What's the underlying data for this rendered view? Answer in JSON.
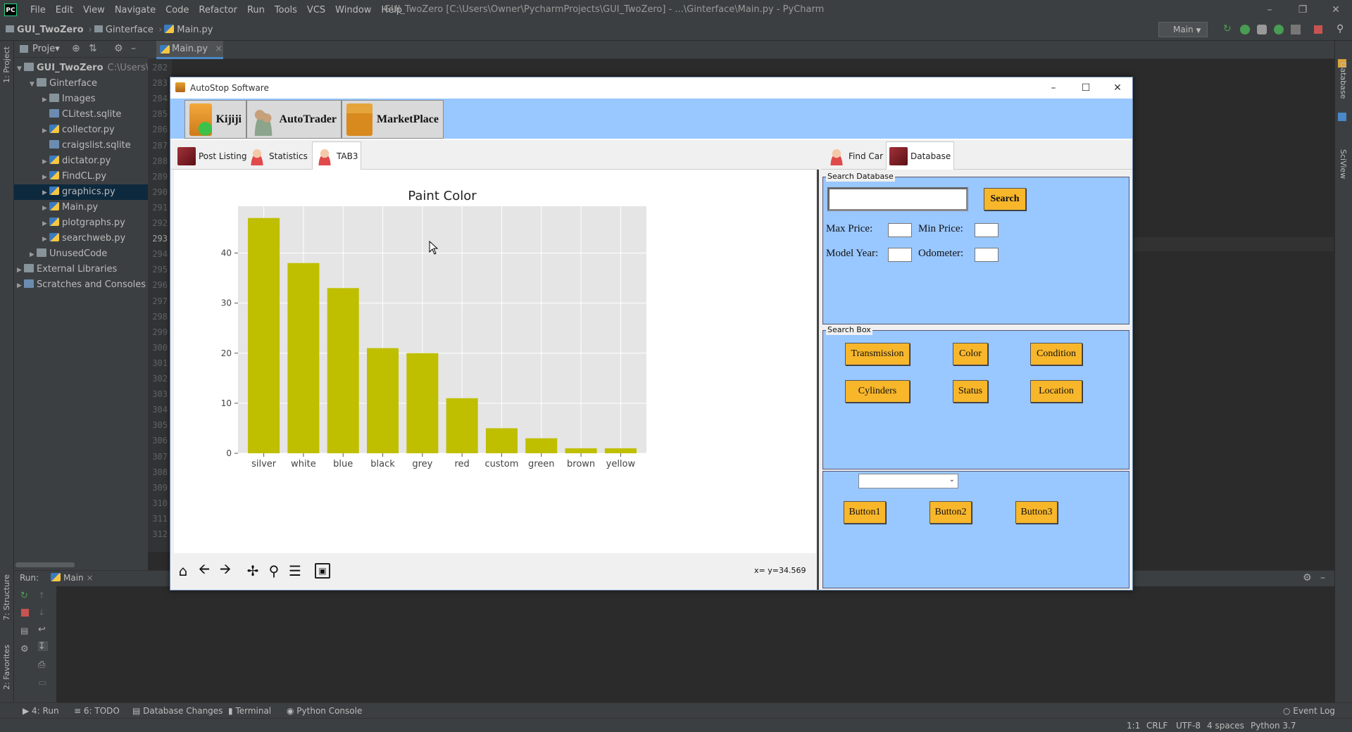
{
  "ide": {
    "menu": [
      "File",
      "Edit",
      "View",
      "Navigate",
      "Code",
      "Refactor",
      "Run",
      "Tools",
      "VCS",
      "Window",
      "Help"
    ],
    "window_title": "GUI_TwoZero [C:\\Users\\Owner\\PycharmProjects\\GUI_TwoZero] - ...\\Ginterface\\Main.py - PyCharm",
    "breadcrumb": [
      "GUI_TwoZero",
      "Ginterface",
      "Main.py"
    ],
    "run_config": "Main",
    "project_label": "Proje▾",
    "left_strip": [
      "1: Project",
      "7: Structure",
      "2: Favorites"
    ],
    "right_strip": [
      "Database",
      "SciView"
    ],
    "editor_tab": "Main.py",
    "project_tree": [
      {
        "label": "GUI_TwoZero",
        "extra": "C:\\Users\\O",
        "indent": 0,
        "type": "folder",
        "twist": "▼"
      },
      {
        "label": "Ginterface",
        "indent": 1,
        "type": "folder",
        "twist": "▼"
      },
      {
        "label": "Images",
        "indent": 2,
        "type": "folder",
        "twist": "▶"
      },
      {
        "label": "CLitest.sqlite",
        "indent": 2,
        "type": "sqlite",
        "twist": ""
      },
      {
        "label": "collector.py",
        "indent": 2,
        "type": "py",
        "twist": "▶"
      },
      {
        "label": "craigslist.sqlite",
        "indent": 2,
        "type": "sqlite",
        "twist": ""
      },
      {
        "label": "dictator.py",
        "indent": 2,
        "type": "py",
        "twist": "▶"
      },
      {
        "label": "FindCL.py",
        "indent": 2,
        "type": "py",
        "twist": "▶"
      },
      {
        "label": "graphics.py",
        "indent": 2,
        "type": "py",
        "twist": "▶",
        "selected": true
      },
      {
        "label": "Main.py",
        "indent": 2,
        "type": "py",
        "twist": "▶"
      },
      {
        "label": "plotgraphs.py",
        "indent": 2,
        "type": "py",
        "twist": "▶"
      },
      {
        "label": "searchweb.py",
        "indent": 2,
        "type": "py",
        "twist": "▶"
      },
      {
        "label": "UnusedCode",
        "indent": 1,
        "type": "folder",
        "twist": "▶"
      },
      {
        "label": "External Libraries",
        "indent": 0,
        "type": "lib",
        "twist": "▶"
      },
      {
        "label": "Scratches and Consoles",
        "indent": 0,
        "type": "scratch",
        "twist": "▶"
      }
    ],
    "line_numbers": [
      "282",
      "283",
      "284",
      "285",
      "286",
      "287",
      "288",
      "289",
      "290",
      "291",
      "292",
      "293",
      "294",
      "295",
      "296",
      "297",
      "298",
      "299",
      "300",
      "301",
      "302",
      "303",
      "304",
      "305",
      "306",
      "307",
      "308",
      "309",
      "310",
      "311",
      "312"
    ],
    "run_label": "Run:",
    "run_tab": "Main",
    "bottom_tabs": [
      "4: Run",
      "6: TODO",
      "Database Changes",
      "Terminal",
      "Python Console"
    ],
    "event_log": "Event Log",
    "status": [
      "1:1",
      "CRLF",
      "UTF-8",
      "4 spaces",
      "Python 3.7"
    ]
  },
  "app": {
    "title": "AutoStop Software",
    "top_buttons": [
      "Kijiji",
      "AutoTrader",
      "MarketPlace"
    ],
    "left_tabs": [
      "Post Listing",
      "Statistics",
      "TAB3"
    ],
    "right_tabs": [
      "Find Car",
      "Database"
    ],
    "coord_readout": "x= y=34.569",
    "search_db": {
      "frame_label": "Search Database",
      "search_button": "Search",
      "max_price": "Max Price:",
      "min_price": "Min Price:",
      "model_year": "Model Year:",
      "odometer": "Odometer:"
    },
    "search_box": {
      "frame_label": "Search Box",
      "buttons": [
        "Transmission",
        "Color",
        "Condition",
        "Cylinders",
        "Status",
        "Location"
      ]
    },
    "bottom_buttons": [
      "Button1",
      "Button2",
      "Button3"
    ]
  },
  "chart_data": {
    "type": "bar",
    "title": "Paint Color",
    "xlabel": "",
    "ylabel": "",
    "categories": [
      "silver",
      "white",
      "blue",
      "black",
      "grey",
      "red",
      "custom",
      "green",
      "brown",
      "yellow"
    ],
    "values": [
      47,
      38,
      33,
      21,
      20,
      11,
      5,
      3,
      1,
      1
    ],
    "ylim": [
      0,
      49.35
    ],
    "yticks": [
      0,
      10,
      20,
      30,
      40
    ],
    "bar_color": "#bfbf00",
    "grid": true,
    "background": "#e5e5e5"
  }
}
